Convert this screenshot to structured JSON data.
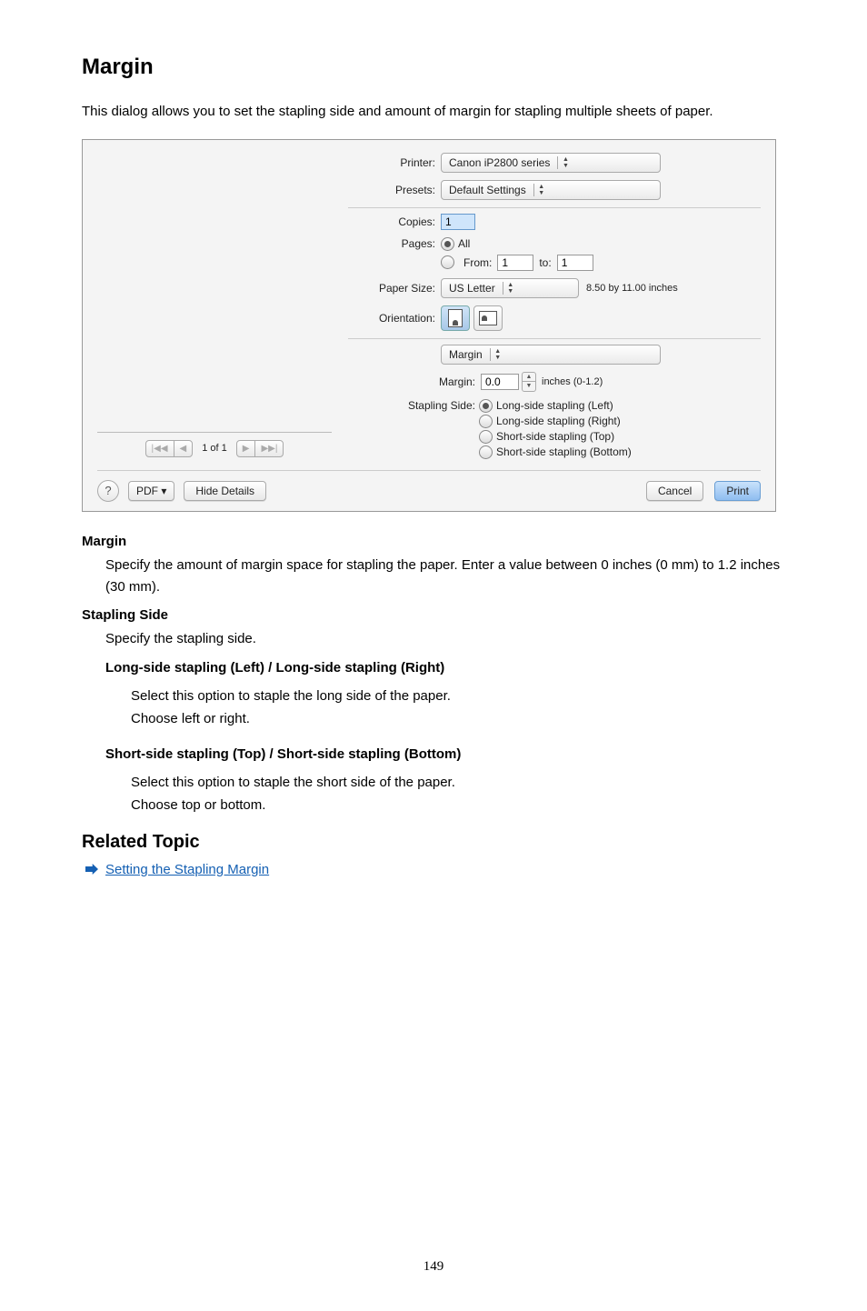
{
  "heading": "Margin",
  "intro": "This dialog allows you to set the stapling side and amount of margin for stapling multiple sheets of paper.",
  "screenshot": {
    "printer_label": "Printer:",
    "printer_value": "Canon iP2800 series",
    "presets_label": "Presets:",
    "presets_value": "Default Settings",
    "copies_label": "Copies:",
    "copies_value": "1",
    "pages_label": "Pages:",
    "pages_all": "All",
    "pages_from_label": "From:",
    "pages_from_value": "1",
    "pages_to_label": "to:",
    "pages_to_value": "1",
    "paper_size_label": "Paper Size:",
    "paper_size_value": "US Letter",
    "paper_dims": "8.50 by 11.00 inches",
    "orientation_label": "Orientation:",
    "pane_value": "Margin",
    "margin_label": "Margin:",
    "margin_value": "0.0",
    "margin_range": "inches (0-1.2)",
    "stapling_side_label": "Stapling Side:",
    "stapling_opts": [
      "Long-side stapling (Left)",
      "Long-side stapling (Right)",
      "Short-side stapling (Top)",
      "Short-side stapling (Bottom)"
    ],
    "preview_page": "1 of 1",
    "help": "?",
    "pdf_btn": "PDF ▾",
    "hide_details_btn": "Hide Details",
    "cancel_btn": "Cancel",
    "print_btn": "Print"
  },
  "desc": {
    "margin_term": "Margin",
    "margin_def": "Specify the amount of margin space for stapling the paper. Enter a value between 0 inches (0 mm) to 1.2 inches (30 mm).",
    "stapling_term": "Stapling Side",
    "stapling_def": "Specify the stapling side.",
    "long_term": "Long-side stapling (Left) / Long-side stapling (Right)",
    "long_def1": "Select this option to staple the long side of the paper.",
    "long_def2": "Choose left or right.",
    "short_term": "Short-side stapling (Top) / Short-side stapling (Bottom)",
    "short_def1": "Select this option to staple the short side of the paper.",
    "short_def2": "Choose top or bottom."
  },
  "related_heading": "Related Topic",
  "related_link": "Setting the Stapling Margin",
  "page_number": "149"
}
